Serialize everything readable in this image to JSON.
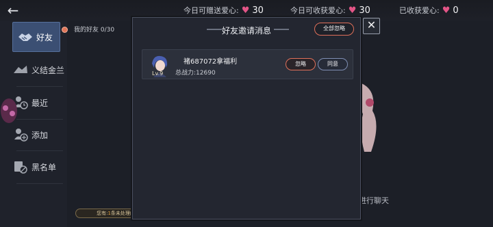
{
  "topbar": {
    "send_label": "今日可赠送爱心:",
    "send_value": "30",
    "receive_label": "今日可收获爱心:",
    "receive_value": "30",
    "received_label": "已收获爱心:",
    "received_value": "0"
  },
  "sidebar": {
    "items": [
      {
        "label": "好友",
        "icon": "handshake-icon"
      },
      {
        "label": "义结金兰",
        "icon": "sworn-brothers-icon"
      },
      {
        "label": "最近",
        "icon": "recent-clock-icon"
      },
      {
        "label": "添加",
        "icon": "add-friend-icon"
      },
      {
        "label": "黑名单",
        "icon": "blacklist-icon"
      }
    ]
  },
  "friends": {
    "header_label": "我的好友",
    "count": "0/30"
  },
  "background": {
    "chat_hint": "进行聊天",
    "pending_prefix": "您有",
    "pending_count": "1",
    "pending_suffix": "条未处理的邀请信息"
  },
  "modal": {
    "title": "好友邀请消息",
    "ignore_all_label": "全部忽略",
    "close_label": "✕",
    "invites": [
      {
        "name": "褚687072拿福利",
        "level": "Lv.9",
        "power_label": "总战力:",
        "power_value": "12690",
        "ignore_label": "忽略",
        "accept_label": "同意"
      }
    ]
  },
  "colors": {
    "heart": "#e35587",
    "accent_red": "#e0705a",
    "accent_blue": "#7f8fb4",
    "active_tab": "#3b4f73"
  }
}
